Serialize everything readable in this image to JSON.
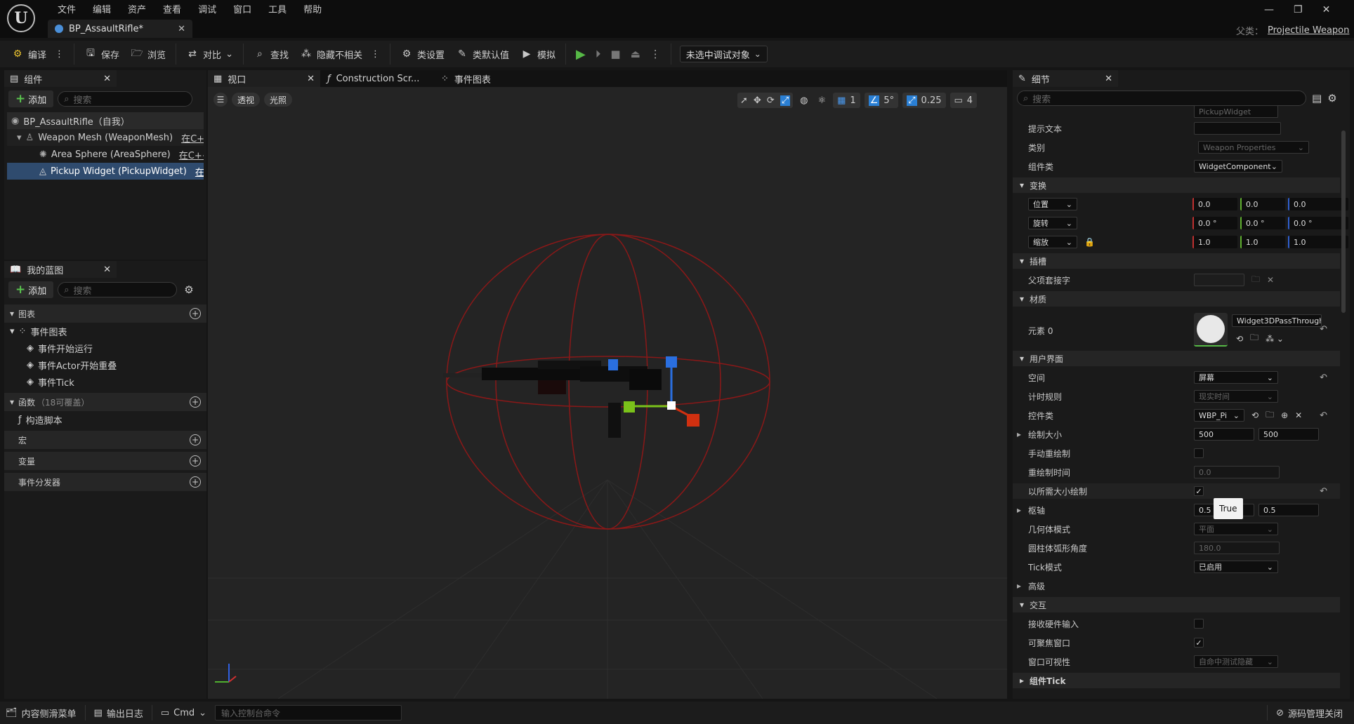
{
  "menu": [
    "文件",
    "编辑",
    "资产",
    "查看",
    "调试",
    "窗口",
    "工具",
    "帮助"
  ],
  "doc_tab": "BP_AssaultRifle*",
  "parent": {
    "label": "父类：",
    "value": "Projectile Weapon"
  },
  "toolbar": {
    "compile": "编译",
    "save": "保存",
    "browse": "浏览",
    "diff": "对比",
    "find": "查找",
    "hide_unrelated": "隐藏不相关",
    "class_settings": "类设置",
    "class_defaults": "类默认值",
    "simulate": "模拟",
    "debug_target": "未选中调试对象"
  },
  "components": {
    "tab": "组件",
    "add": "添加",
    "search_placeholder": "搜索",
    "items": [
      {
        "label": "BP_AssaultRifle（自我）",
        "link": ""
      },
      {
        "label": "Weapon Mesh (WeaponMesh)",
        "link": "在C++中"
      },
      {
        "label": "Area Sphere (AreaSphere)",
        "link": "在C++中编"
      },
      {
        "label": "Pickup Widget (PickupWidget)",
        "link": "在C++"
      }
    ]
  },
  "my_blueprint": {
    "tab": "我的蓝图",
    "add": "添加",
    "search_placeholder": "搜索",
    "graphs_label": "图表",
    "event_graph": "事件图表",
    "events": [
      "事件开始运行",
      "事件Actor开始重叠",
      "事件Tick"
    ],
    "functions_label": "函数",
    "functions_count": "（18可覆盖）",
    "construction": "构造脚本",
    "macros_label": "宏",
    "variables_label": "变量",
    "dispatchers_label": "事件分发器"
  },
  "center_tabs": [
    "视口",
    "Construction Scr...",
    "事件图表"
  ],
  "viewport": {
    "perspective": "透视",
    "lit": "光照",
    "grid_snap": "1",
    "rot_snap": "5°",
    "scale_snap": "0.25",
    "cam_speed": "4"
  },
  "details": {
    "tab": "细节",
    "search_placeholder": "搜索",
    "var_name_value": "PickupWidget",
    "tooltip_label": "提示文本",
    "category_label": "类别",
    "category_value": "Weapon Properties",
    "comp_class_label": "组件类",
    "comp_class_value": "WidgetComponent",
    "transform_label": "变换",
    "location_label": "位置",
    "rotation_label": "旋转",
    "scale_label": "缩放",
    "location": [
      "0.0",
      "0.0",
      "0.0"
    ],
    "rotation": [
      "0.0 °",
      "0.0 °",
      "0.0 °"
    ],
    "scale": [
      "1.0",
      "1.0",
      "1.0"
    ],
    "sockets_label": "插槽",
    "parent_socket_label": "父项套接字",
    "materials_label": "材质",
    "element0_label": "元素 0",
    "material_value": "Widget3DPassThrough_",
    "ui_label": "用户界面",
    "space_label": "空间",
    "space_value": "屏幕",
    "timing_label": "计时规则",
    "timing_value": "现实时间",
    "widget_class_label": "控件类",
    "widget_class_value": "WBP_Pi",
    "draw_size_label": "绘制大小",
    "draw_size": [
      "500",
      "500"
    ],
    "manual_redraw_label": "手动重绘制",
    "redraw_time_label": "重绘制时间",
    "redraw_time_value": "0.0",
    "desired_size_label": "以所需大小绘制",
    "pivot_label": "枢轴",
    "pivot": [
      "0.5",
      "0.5"
    ],
    "tooltip_true": "True",
    "geometry_label": "几何体模式",
    "geometry_value": "平面",
    "cylinder_label": "圆柱体弧形角度",
    "cylinder_value": "180.0",
    "tick_mode_label": "Tick模式",
    "tick_mode_value": "已启用",
    "advanced_label": "高级",
    "interaction_label": "交互",
    "hw_input_label": "接收硬件输入",
    "focusable_label": "可聚焦窗口",
    "visibility_label": "窗口可视性",
    "visibility_value": "自命中测试隐藏",
    "comp_tick_label": "组件Tick"
  },
  "statusbar": {
    "drawer": "内容侧滑菜单",
    "output": "输出日志",
    "cmd": "Cmd",
    "console_placeholder": "输入控制台命令",
    "source_control": "源码管理关闭"
  },
  "colors": {
    "accent": "#2a7fd4",
    "play": "#56b846",
    "bg": "#151515",
    "panel": "#1a1a1a"
  }
}
